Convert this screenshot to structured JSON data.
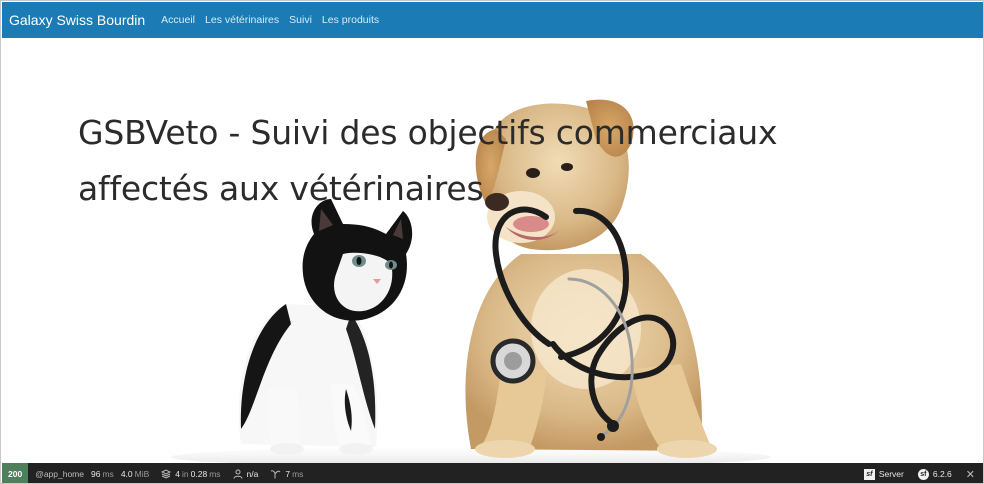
{
  "navbar": {
    "brand": "Galaxy Swiss Bourdin",
    "links": [
      "Accueil",
      "Les vétérinaires",
      "Suivi",
      "Les produits"
    ]
  },
  "hero": {
    "title": "GSBVeto - Suivi des objectifs commerciaux affectés aux vétérinaires",
    "image_icon": "kitten-and-puppy-with-stethoscope"
  },
  "debug_toolbar": {
    "status_code": "200",
    "route": "@app_home",
    "time_value": "96",
    "time_unit": "ms",
    "memory_value": "4.0",
    "memory_unit": "MiB",
    "cache_count": "4",
    "cache_in": "in",
    "cache_time": "0.28",
    "cache_unit": "ms",
    "user": "n/a",
    "twig_time": "7",
    "twig_unit": "ms",
    "server_label": "Server",
    "version": "6.2.6",
    "icons": [
      "cache-icon",
      "user-icon",
      "twig-icon",
      "server-icon",
      "symfony-icon",
      "close-icon"
    ]
  },
  "colors": {
    "navbar": "#1a7bb5",
    "toolbar": "#222222",
    "status_ok": "#4f805d"
  }
}
